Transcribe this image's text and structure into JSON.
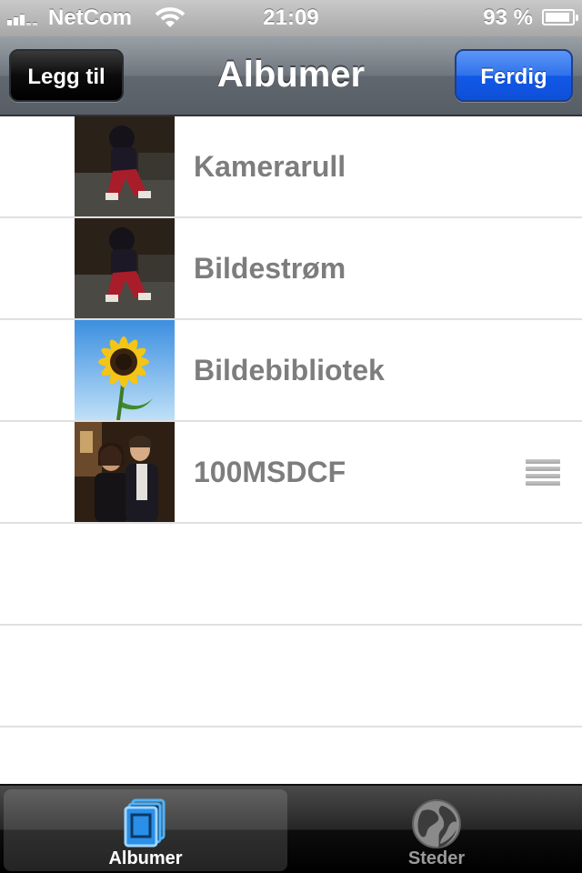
{
  "status_bar": {
    "carrier": "NetCom",
    "time": "21:09",
    "battery_percent": "93 %",
    "battery_level": 0.93,
    "signal_bars": 3,
    "icons": [
      "signal-icon",
      "wifi-icon",
      "battery-icon"
    ]
  },
  "nav": {
    "title": "Albumer",
    "left_button": "Legg til",
    "right_button": "Ferdig"
  },
  "albums": [
    {
      "label": "Kamerarull",
      "thumbnail": "person-in-red-pants-photo"
    },
    {
      "label": "Bildestrøm",
      "thumbnail": "person-in-red-pants-photo"
    },
    {
      "label": "Bildebibliotek",
      "thumbnail": "sunflower-photo"
    },
    {
      "label": "100MSDCF",
      "thumbnail": "couple-portrait-photo",
      "reorder_handle": "reorder-icon"
    }
  ],
  "tabs": [
    {
      "label": "Albumer",
      "icon": "albums-icon",
      "selected": true
    },
    {
      "label": "Steder",
      "icon": "globe-icon",
      "selected": false
    }
  ],
  "colors": {
    "nav_button_done": "#1f66ea",
    "nav_button_add": "#000000",
    "album_label": "#7d7d7d",
    "separator": "#e0e0e0",
    "tab_active_icon": "#4db3ff"
  }
}
